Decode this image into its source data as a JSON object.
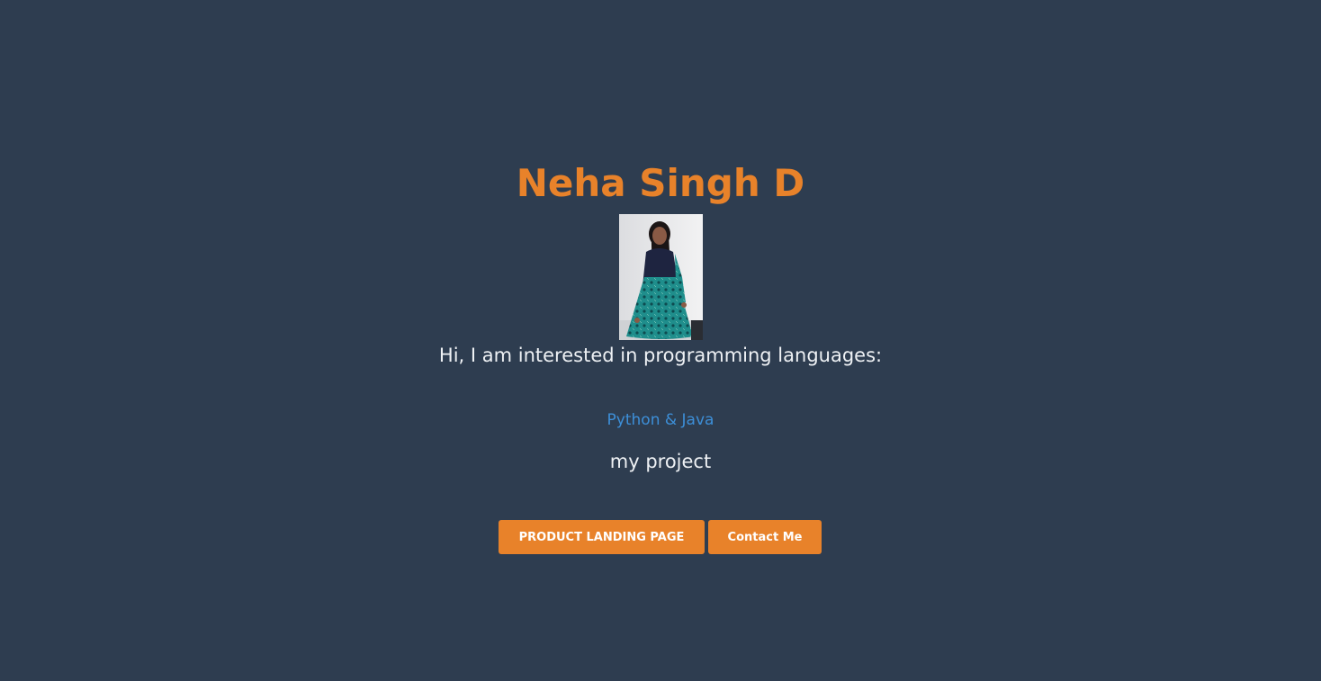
{
  "profile": {
    "name": "Neha Singh D",
    "intro": "Hi, I am interested in programming languages:",
    "languages_link": "Python & Java",
    "project_label": "my project"
  },
  "buttons": {
    "product_landing": "PRODUCT LANDING PAGE",
    "contact": "Contact Me"
  },
  "colors": {
    "background": "#2e3d50",
    "accent": "#e8822a",
    "link": "#3d8fd8",
    "text": "#eef1f4"
  }
}
